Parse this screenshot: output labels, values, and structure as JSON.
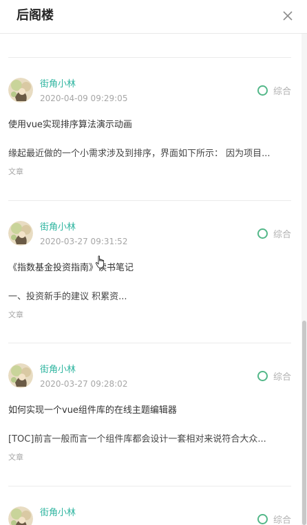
{
  "header": {
    "title": "后阁楼",
    "close_icon": "close-icon"
  },
  "colors": {
    "author": "#2fb5a0",
    "category_ring": "#52b788"
  },
  "posts": [
    {
      "author": "街角小林",
      "time": "2020-04-09 09:29:05",
      "category": "综合",
      "title": "使用vue实现排序算法演示动画",
      "excerpt": "缘起最近做的一个小需求涉及到排序，界面如下所示： 因为项目...",
      "type": "文章"
    },
    {
      "author": "街角小林",
      "time": "2020-03-27 09:31:52",
      "category": "综合",
      "title": "《指数基金投资指南》读书笔记",
      "excerpt": "一、投资新手的建议 积累资...",
      "type": "文章"
    },
    {
      "author": "街角小林",
      "time": "2020-03-27 09:28:02",
      "category": "综合",
      "title": "如何实现一个vue组件库的在线主题编辑器",
      "excerpt": "[TOC]前言一般而言一个组件库都会设计一套相对来说符合大众...",
      "type": "文章"
    },
    {
      "author": "街角小林",
      "time": "",
      "category": "综合",
      "title": "",
      "excerpt": "",
      "type": ""
    }
  ]
}
